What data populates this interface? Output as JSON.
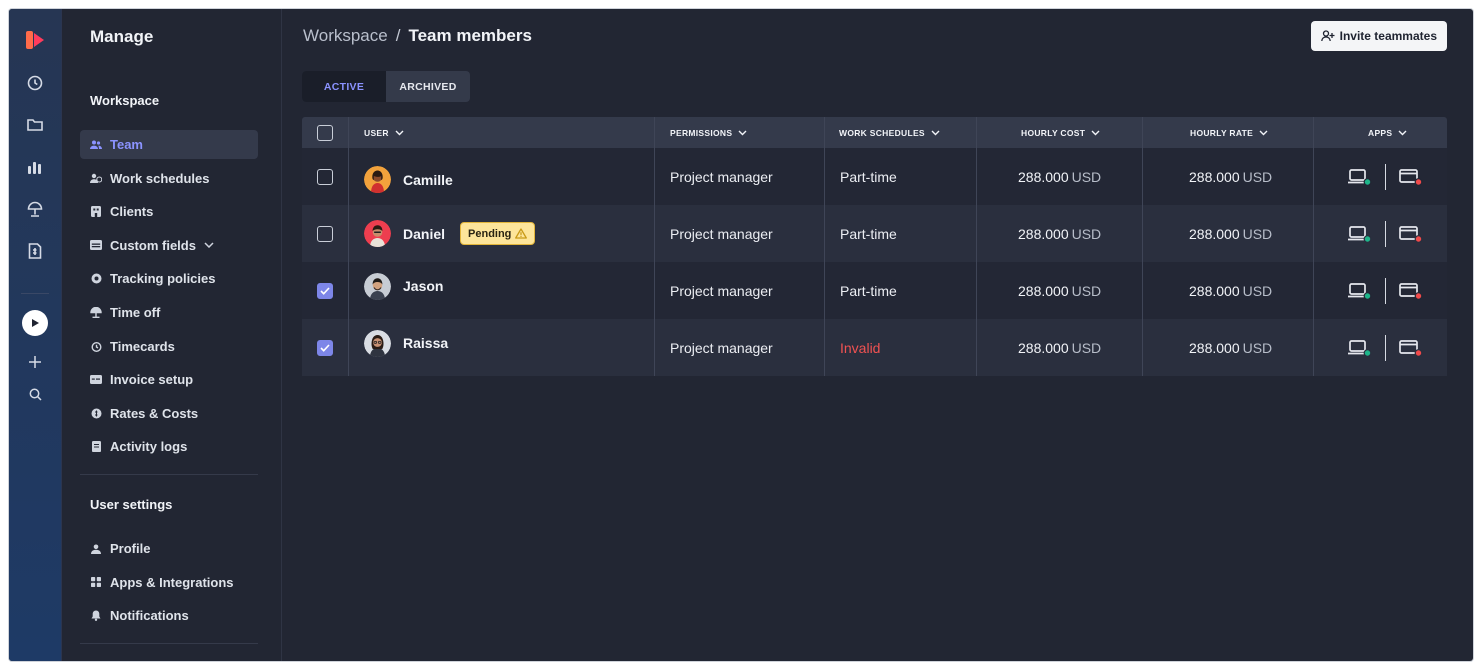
{
  "sidebar": {
    "title": "Manage",
    "workspace_title": "Workspace",
    "workspace_items": [
      {
        "label": "Team",
        "icon": "team-icon",
        "active": true
      },
      {
        "label": "Work schedules",
        "icon": "work-schedules-icon"
      },
      {
        "label": "Clients",
        "icon": "clients-icon"
      },
      {
        "label": "Custom fields",
        "icon": "custom-fields-icon",
        "has_chevron": true
      },
      {
        "label": "Tracking policies",
        "icon": "tracking-policies-icon"
      },
      {
        "label": "Time off",
        "icon": "time-off-icon"
      },
      {
        "label": "Timecards",
        "icon": "timecards-icon"
      },
      {
        "label": "Invoice setup",
        "icon": "invoice-setup-icon"
      },
      {
        "label": "Rates & Costs",
        "icon": "rates-costs-icon"
      },
      {
        "label": "Activity logs",
        "icon": "activity-logs-icon"
      }
    ],
    "user_settings_title": "User settings",
    "user_items": [
      {
        "label": "Profile",
        "icon": "profile-icon"
      },
      {
        "label": "Apps & Integrations",
        "icon": "apps-integrations-icon"
      },
      {
        "label": "Notifications",
        "icon": "notifications-icon"
      }
    ]
  },
  "header": {
    "breadcrumb_root": "Workspace",
    "breadcrumb_sep": "/",
    "breadcrumb_current": "Team members",
    "invite_label": "Invite teammates"
  },
  "tabs": [
    {
      "label": "ACTIVE",
      "active": true
    },
    {
      "label": "ARCHIVED",
      "active": false
    }
  ],
  "table": {
    "columns": {
      "user": "USER",
      "permissions": "PERMISSIONS",
      "work_schedules": "WORK SCHEDULES",
      "hourly_cost": "HOURLY COST",
      "hourly_rate": "HOURLY RATE",
      "apps": "APPS"
    },
    "rows": [
      {
        "name": "Camille",
        "checked": false,
        "badge": "",
        "permission": "Project manager",
        "schedule": "Part-time",
        "schedule_invalid": false,
        "cost_value": "288.000",
        "cost_currency": "USD",
        "rate_value": "288.000",
        "rate_currency": "USD",
        "desktop_status": "online",
        "web_status": "offline"
      },
      {
        "name": "Daniel",
        "checked": false,
        "badge": "Pending",
        "permission": "Project manager",
        "schedule": "Part-time",
        "schedule_invalid": false,
        "cost_value": "288.000",
        "cost_currency": "USD",
        "rate_value": "288.000",
        "rate_currency": "USD",
        "desktop_status": "online",
        "web_status": "offline"
      },
      {
        "name": "Jason",
        "checked": true,
        "badge": "",
        "permission": "Project manager",
        "schedule": "Part-time",
        "schedule_invalid": false,
        "cost_value": "288.000",
        "cost_currency": "USD",
        "rate_value": "288.000",
        "rate_currency": "USD",
        "desktop_status": "online",
        "web_status": "offline"
      },
      {
        "name": "Raissa",
        "checked": true,
        "badge": "",
        "permission": "Project manager",
        "schedule": "Invalid",
        "schedule_invalid": true,
        "cost_value": "288.000",
        "cost_currency": "USD",
        "rate_value": "288.000",
        "rate_currency": "USD",
        "desktop_status": "online",
        "web_status": "offline"
      }
    ]
  },
  "colors": {
    "accent": "#8b93ff",
    "online": "#1fb58a",
    "offline": "#f04a4a",
    "invalid": "#f05252",
    "badge_bg": "#fde59a"
  }
}
